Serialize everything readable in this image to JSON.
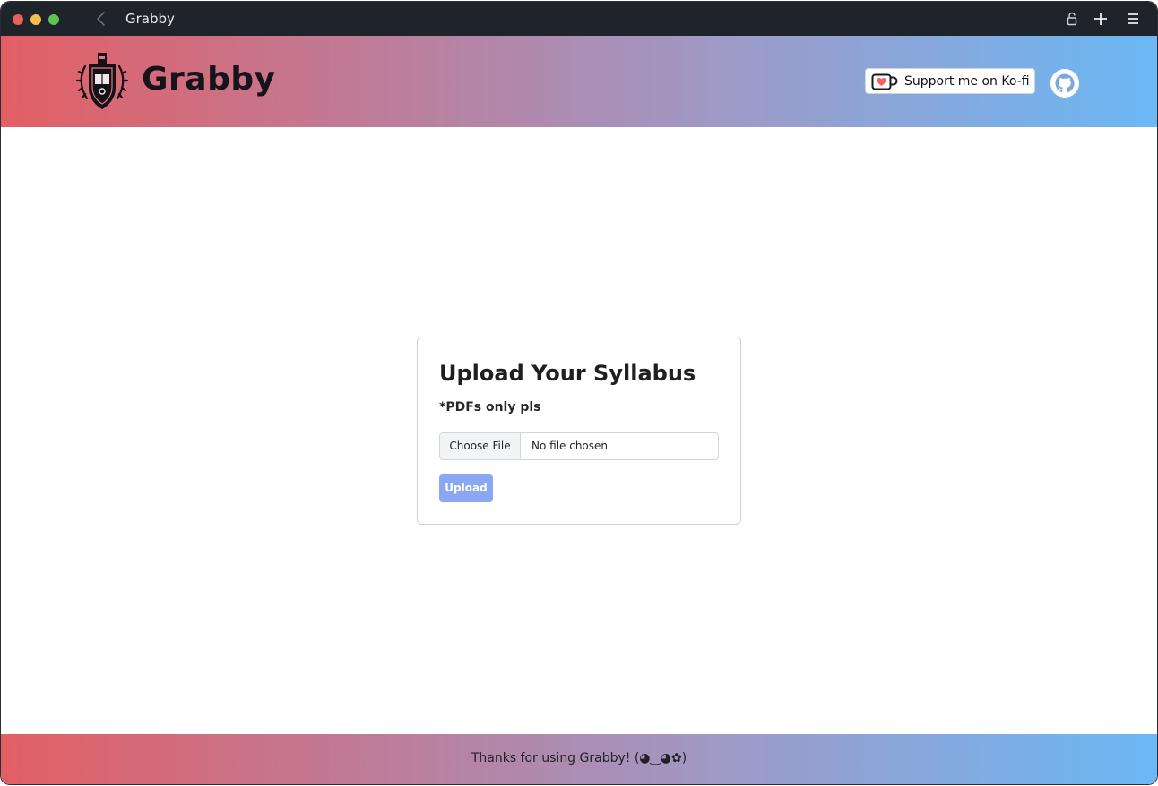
{
  "window": {
    "title": "Grabby",
    "controls": [
      "close",
      "minimize",
      "zoom"
    ],
    "icons": [
      "back-arrow-icon",
      "lock-icon",
      "plus-icon",
      "menu-icon"
    ]
  },
  "header": {
    "brand": "Grabby",
    "logo_icon": "crest-shield-icon",
    "kofi_label": "Support me on Ko-fi",
    "github_icon": "github-icon",
    "gradient_colors": [
      "#e35f64",
      "#c07a95",
      "#9f99c6",
      "#6bb8f5"
    ]
  },
  "upload": {
    "title": "Upload Your Syllabus",
    "subtitle": "*PDFs only pls",
    "choose_file_label": "Choose File",
    "file_status": "No file chosen",
    "upload_label": "Upload",
    "upload_color": "#8ba6f3"
  },
  "footer": {
    "text": "Thanks for using Grabby! (◕‿◕✿)"
  }
}
